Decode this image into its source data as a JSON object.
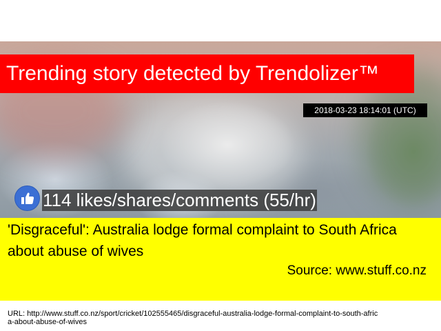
{
  "banner": {
    "title": "Trending story detected by Trendolizer™"
  },
  "timestamp": "2018-03-23 18:14:01 (UTC)",
  "engagement": {
    "icon": "thumbs-up-icon",
    "text": "114 likes/shares/comments (55/hr)"
  },
  "story": {
    "headline": "'Disgraceful': Australia lodge formal complaint to South Africa about abuse of wives",
    "source": "Source: www.stuff.co.nz"
  },
  "url_line": "URL: http://www.stuff.co.nz/sport/cricket/102555465/disgraceful-australia-lodge-formal-complaint-to-south-africa-about-abuse-of-wives",
  "colors": {
    "banner": "#ff0000",
    "panel": "#ffff00",
    "like": "#3b6fd4"
  }
}
